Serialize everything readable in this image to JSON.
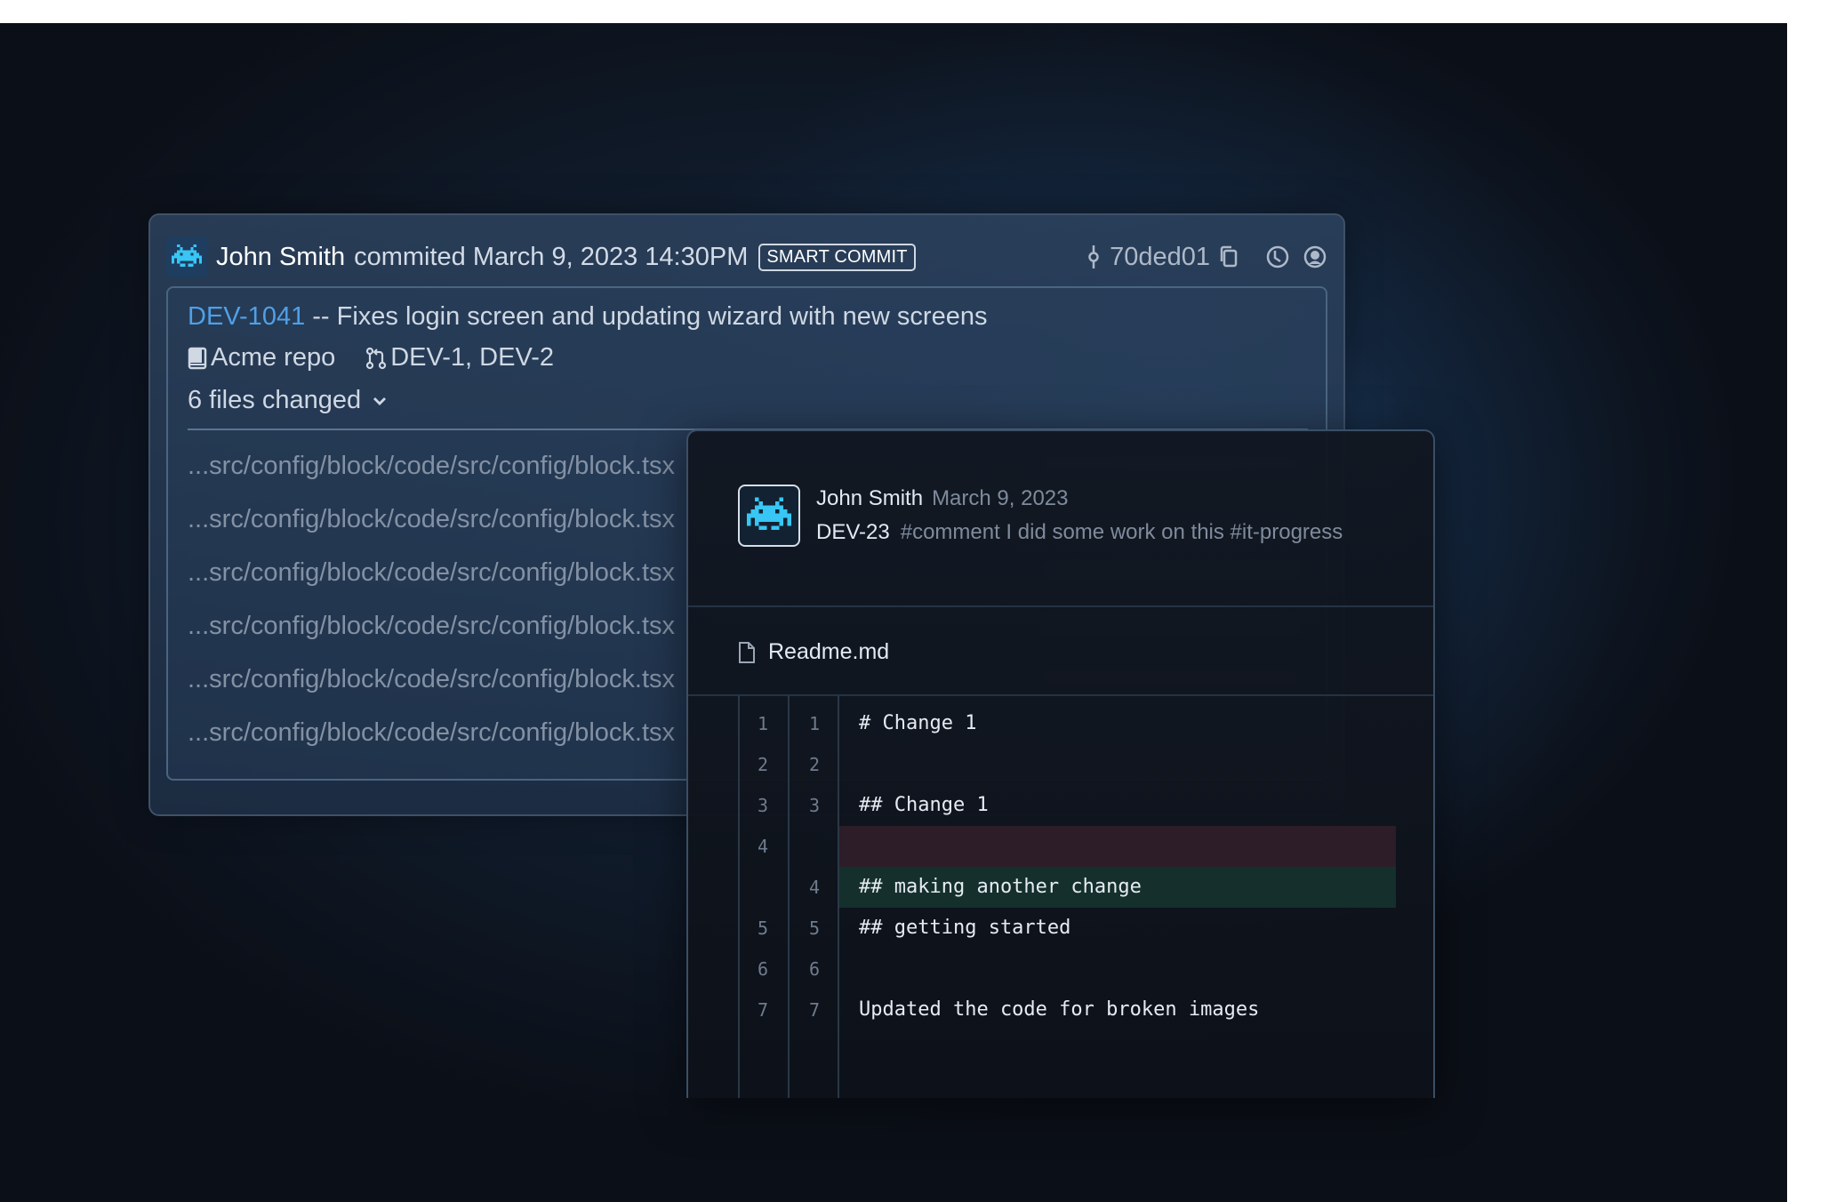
{
  "colors": {
    "background": "#0b0f17",
    "link": "#4fa0e8",
    "deleted_row": "#2c1d28",
    "added_row": "#15302c"
  },
  "commit": {
    "author": "John Smith",
    "action": "commited March 9, 2023 14:30PM",
    "badge": "SMART COMMIT",
    "hash": "70ded01",
    "issue_key": "DEV-1041",
    "message": " -- Fixes login screen and updating wizard with new screens",
    "repo": "Acme repo",
    "linked_issues": "DEV-1, DEV-2",
    "files_changed_label": "6 files changed",
    "files": [
      "...src/config/block/code/src/config/block.tsx",
      "...src/config/block/code/src/config/block.tsx",
      "...src/config/block/code/src/config/block.tsx",
      "...src/config/block/code/src/config/block.tsx",
      "...src/config/block/code/src/config/block.tsx",
      "...src/config/block/code/src/config/block.tsx"
    ],
    "icons": [
      "avatar-icon",
      "commit-icon",
      "copy-icon",
      "history-icon",
      "globe-icon",
      "repo-book-icon",
      "pull-request-icon",
      "chevron-down-icon"
    ]
  },
  "comment": {
    "author": "John Smith",
    "date": "March 9, 2023",
    "issue_key": "DEV-23",
    "text": "#comment I did some work on this #it-progress",
    "file_name": "Readme.md"
  },
  "diff": [
    {
      "old": "1",
      "new": "1",
      "code": "# Change 1",
      "type": "context"
    },
    {
      "old": "2",
      "new": "2",
      "code": "",
      "type": "context"
    },
    {
      "old": "3",
      "new": "3",
      "code": "## Change 1",
      "type": "context"
    },
    {
      "old": "4",
      "new": "",
      "code": "",
      "type": "del"
    },
    {
      "old": "",
      "new": "4",
      "code": "## making another change",
      "type": "add"
    },
    {
      "old": "5",
      "new": "5",
      "code": "## getting started",
      "type": "context"
    },
    {
      "old": "6",
      "new": "6",
      "code": "",
      "type": "context"
    },
    {
      "old": "7",
      "new": "7",
      "code": "Updated the code for broken images",
      "type": "context"
    }
  ]
}
